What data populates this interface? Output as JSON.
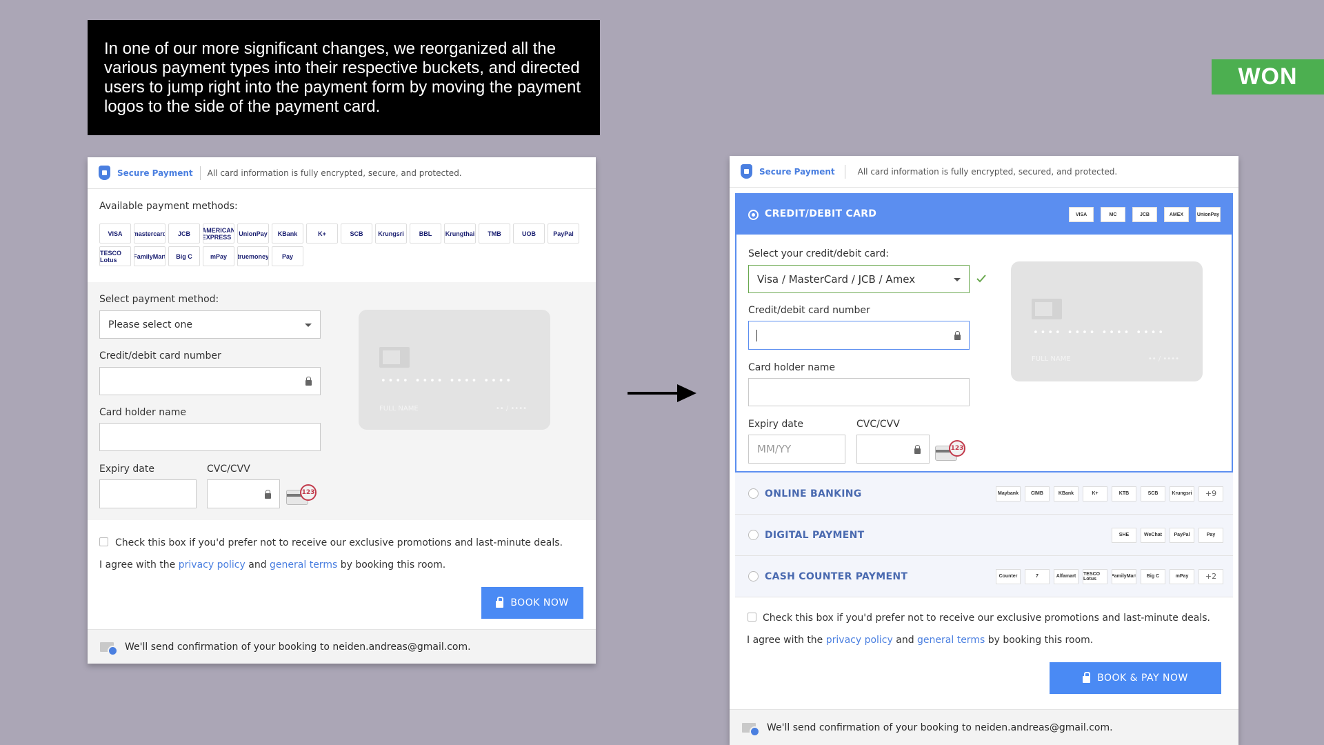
{
  "caption": "In one of our more significant changes, we reorganized all the various payment types into their respective buckets, and directed users to jump right into the payment form by moving the payment logos to the side of the payment card.",
  "badge": "WON",
  "colors": {
    "accent": "#4a8af4",
    "won": "#4caf50",
    "selected_border": "#6aa84f"
  },
  "before": {
    "secure_label": "Secure Payment",
    "secure_info": "All card information is fully encrypted, secure, and protected.",
    "available_label": "Available payment methods:",
    "logos": [
      "VISA",
      "mastercard",
      "JCB",
      "AMERICAN EXPRESS",
      "UnionPay",
      "KBank",
      "K+",
      "SCB",
      "Krungsri",
      "BBL",
      "Krungthai",
      "TMB",
      "UOB",
      "PayPal",
      "TESCO Lotus",
      "FamilyMart",
      "Big C",
      "mPay",
      "truemoney",
      "Pay"
    ],
    "select_method_label": "Select payment method:",
    "select_placeholder": "Please select one",
    "card_number_label": "Credit/debit card number",
    "holder_label": "Card holder name",
    "expiry_label": "Expiry date",
    "cvc_label": "CVC/CVV",
    "cvv_badge": "123",
    "card_dots": "•••• •••• •••• ••••",
    "card_name": "FULL NAME",
    "card_exp": "•• / ••••",
    "promo_text": "Check this box if you'd prefer not to receive our exclusive promotions and last-minute deals.",
    "agree_prefix": "I agree with the ",
    "privacy": "privacy policy",
    "and": " and ",
    "terms": "general terms",
    "agree_suffix": " by booking this room.",
    "book_button": "BOOK NOW",
    "confirmation": "We'll send confirmation of your booking to neiden.andreas@gmail.com."
  },
  "after": {
    "secure_label": "Secure Payment",
    "secure_info": "All card information is fully encrypted, secured, and protected.",
    "credit_header": "CREDIT/DEBIT CARD",
    "credit_logos": [
      "VISA",
      "MC",
      "JCB",
      "AMEX",
      "UnionPay"
    ],
    "select_card_label": "Select your credit/debit card:",
    "select_card_value": "Visa / MasterCard / JCB / Amex",
    "card_number_label": "Credit/debit card number",
    "holder_label": "Card holder name",
    "expiry_label": "Expiry date",
    "expiry_placeholder": "MM/YY",
    "cvc_label": "CVC/CVV",
    "cvv_badge": "123",
    "card_dots": "•••• •••• •••• ••••",
    "card_name": "FULL NAME",
    "card_exp": "•• / ••••",
    "online_banking": "ONLINE BANKING",
    "online_logos": [
      "Maybank",
      "CIMB",
      "KBank",
      "K+",
      "KTB",
      "SCB",
      "Krungsri"
    ],
    "online_more": "+9",
    "digital_payment": "DIGITAL PAYMENT",
    "digital_logos": [
      "SHE",
      "WeChat",
      "PayPal",
      " Pay"
    ],
    "cash_counter": "CASH COUNTER PAYMENT",
    "cash_logos": [
      "Counter",
      "7",
      "Alfamart",
      "TESCO Lotus",
      "FamilyMart",
      "Big C",
      "mPay"
    ],
    "cash_more": "+2",
    "promo_text": "Check this box if you'd prefer not to receive our exclusive promotions and last-minute deals.",
    "agree_prefix": "I agree with the ",
    "privacy": "privacy policy",
    "and": " and ",
    "terms": "general terms",
    "agree_suffix": " by booking this room.",
    "book_button": "BOOK & PAY NOW",
    "confirmation": "We'll send confirmation of your booking to neiden.andreas@gmail.com."
  }
}
